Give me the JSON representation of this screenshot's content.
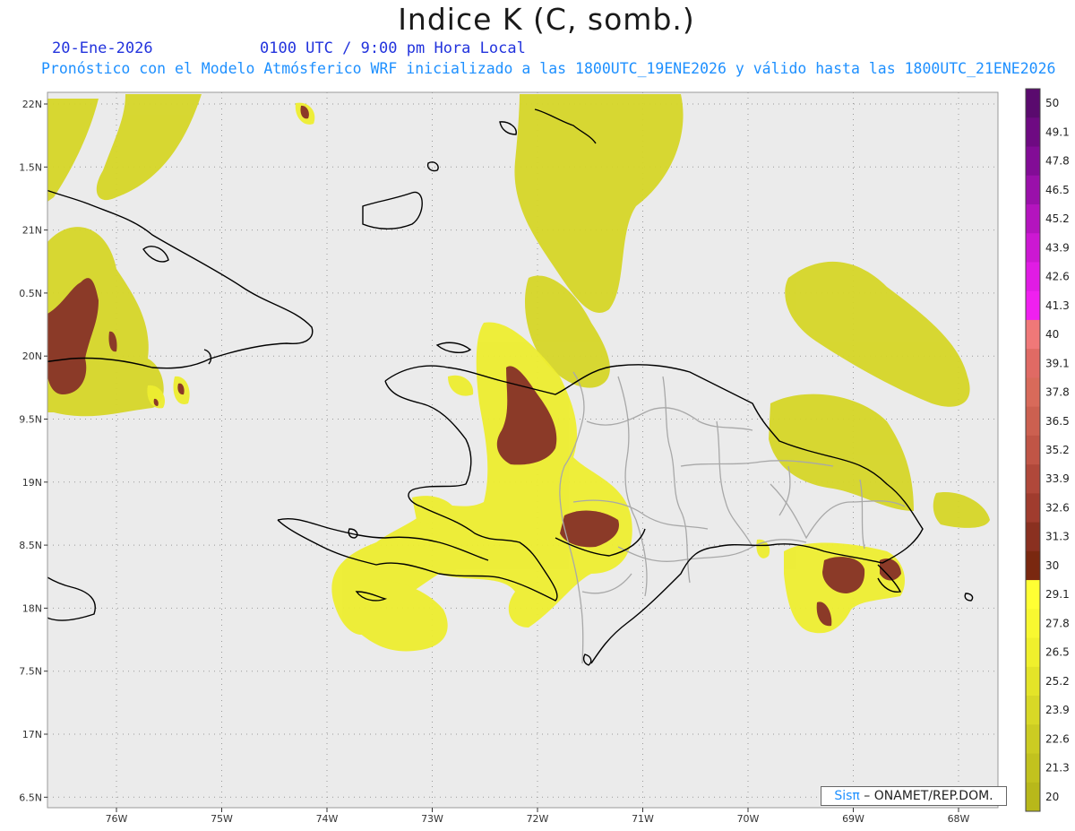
{
  "header": {
    "title": "Indice K (C, somb.)",
    "date": "20-Ene-2026",
    "time": "0100 UTC / 9:00 pm Hora Local",
    "subtitle": "Pronóstico con el Modelo Atmósferico WRF inicializado a las 1800UTC_19ENE2026 y válido hasta las  1800UTC_21ENE2026"
  },
  "axes": {
    "lon_labels": [
      "76W",
      "75W",
      "74W",
      "73W",
      "72W",
      "71W",
      "70W",
      "69W",
      "68W"
    ],
    "lat_labels": [
      "22N",
      "1.5N",
      "21N",
      "0.5N",
      "20N",
      "9.5N",
      "19N",
      "8.5N",
      "18N",
      "7.5N",
      "17N",
      "6.5N"
    ]
  },
  "colorbar": {
    "labels": [
      "50",
      "49.1",
      "47.8",
      "46.5",
      "45.2",
      "43.9",
      "42.6",
      "41.3",
      "40",
      "39.1",
      "37.8",
      "36.5",
      "35.2",
      "33.9",
      "32.6",
      "31.3",
      "30",
      "29.1",
      "27.8",
      "26.5",
      "25.2",
      "23.9",
      "22.6",
      "21.3",
      "20"
    ],
    "colors": [
      "#5a0a6e",
      "#6e0a82",
      "#820c96",
      "#9a10aa",
      "#b414be",
      "#cc18d2",
      "#e01ce4",
      "#f020f0",
      "#f07878",
      "#e06a64",
      "#d86a5a",
      "#cc6050",
      "#c05546",
      "#b0483a",
      "#a03c2e",
      "#8a3020",
      "#7a2810",
      "#ffff33",
      "#f8f830",
      "#f0f02c",
      "#e4e428",
      "#d8d826",
      "#cccc22",
      "#c2c21e",
      "#b8b81a"
    ]
  },
  "credit": {
    "sis": "Sisπ",
    "rest": " – ONAMET/REP.DOM."
  },
  "colors": {
    "map_background": "#ebebeb",
    "coastline": "#000000",
    "provinces": "#a8a8a8"
  }
}
